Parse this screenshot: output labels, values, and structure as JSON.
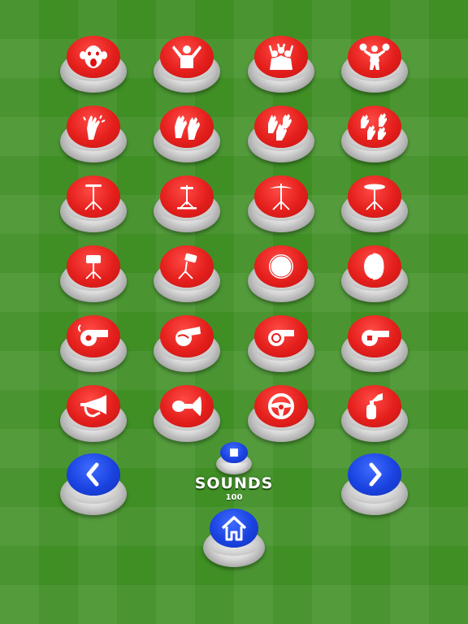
{
  "sound_buttons": [
    {
      "icon": "screaming-monkey-icon"
    },
    {
      "icon": "cheering-fan-icon"
    },
    {
      "icon": "crowd-cheering-icon"
    },
    {
      "icon": "cheerleader-icon"
    },
    {
      "icon": "clapping-hands-icon"
    },
    {
      "icon": "two-clapping-hands-icon"
    },
    {
      "icon": "three-clapping-hands-icon"
    },
    {
      "icon": "crowd-clapping-hands-icon"
    },
    {
      "icon": "cymbal-stand-icon"
    },
    {
      "icon": "hihat-stand-icon"
    },
    {
      "icon": "crash-cymbal-icon"
    },
    {
      "icon": "ride-cymbal-icon"
    },
    {
      "icon": "snare-drum-icon"
    },
    {
      "icon": "tom-drum-icon"
    },
    {
      "icon": "bass-drum-icon"
    },
    {
      "icon": "tambourine-drum-icon"
    },
    {
      "icon": "whistle-icon"
    },
    {
      "icon": "referee-whistle-icon"
    },
    {
      "icon": "sports-whistle-icon"
    },
    {
      "icon": "pea-whistle-icon"
    },
    {
      "icon": "bugle-horn-icon"
    },
    {
      "icon": "bike-horn-icon"
    },
    {
      "icon": "steering-wheel-horn-icon"
    },
    {
      "icon": "air-horn-icon"
    }
  ],
  "navigation": {
    "prev_icon": "chevron-left-icon",
    "next_icon": "chevron-right-icon",
    "stop_icon": "stop-icon",
    "home_icon": "home-icon"
  },
  "footer": {
    "title": "SOUNDS",
    "count": "100"
  },
  "colors": {
    "button_red": "#e41f1c",
    "button_blue": "#1a42e0",
    "field_green": "#3f8f25"
  }
}
